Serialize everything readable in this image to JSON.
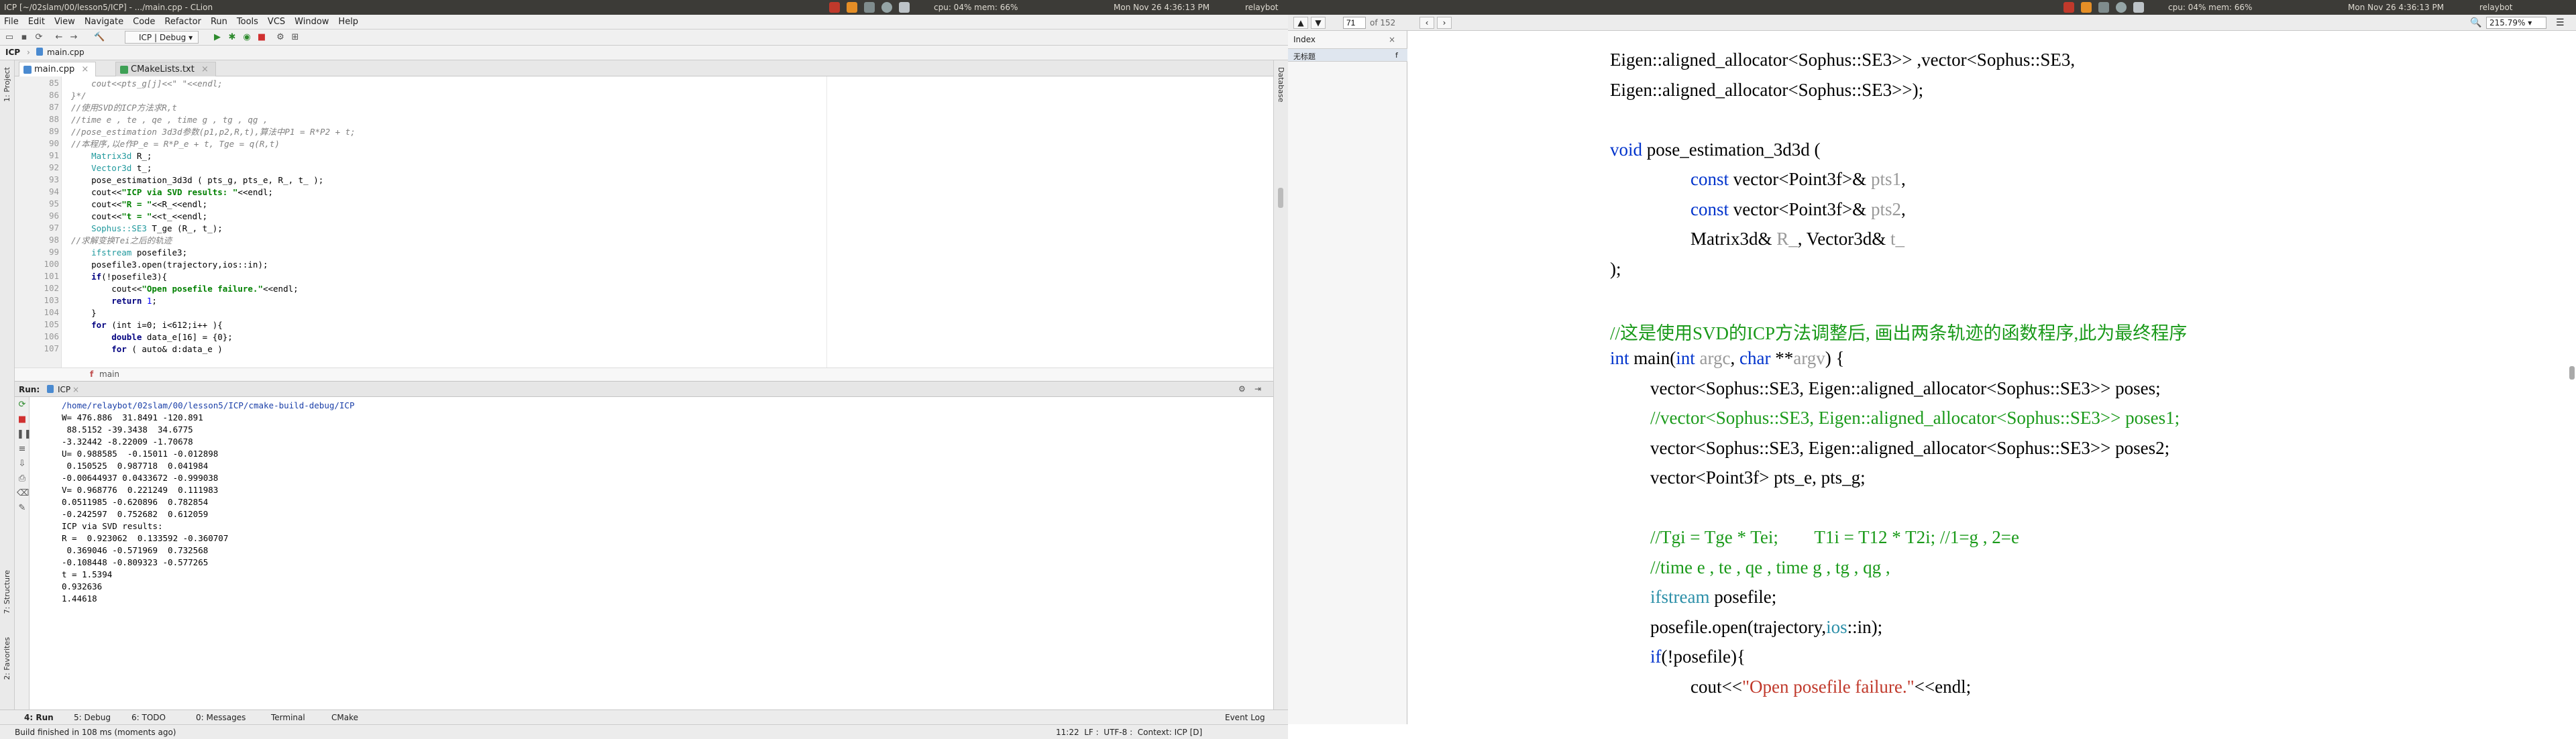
{
  "topbar": {
    "title": "ICP [~/02slam/00/lesson5/ICP] - .../main.cpp - CLion",
    "sys_left": "cpu: 04% mem: 66%",
    "clock_left": "Mon Nov 26 4:36:13 PM",
    "user_left": "relaybot",
    "sys_right": "cpu: 04% mem: 66%",
    "clock_right": "Mon Nov 26 4:36:13 PM",
    "user_right": "relaybot"
  },
  "ide": {
    "menu": [
      "File",
      "Edit",
      "View",
      "Navigate",
      "Code",
      "Refactor",
      "Run",
      "Tools",
      "VCS",
      "Window",
      "Help"
    ],
    "run_config": "ICP | Debug",
    "nav": {
      "project": "ICP",
      "file": "main.cpp"
    },
    "left_tabs": [
      "1: Project",
      "7: Structure",
      "2: Favorites"
    ],
    "right_tab": "Database",
    "tabs": [
      {
        "label": "main.cpp"
      },
      {
        "label": "CMakeLists.txt"
      }
    ],
    "crumb": "main",
    "code_lines": [
      {
        "n": "85",
        "segs": [
          [
            "cm",
            "    cout<<pts_g[j]<<\" \"<<endl;"
          ]
        ]
      },
      {
        "n": "86",
        "segs": [
          [
            "cm",
            "}*/"
          ]
        ]
      },
      {
        "n": "87",
        "segs": [
          [
            "cm",
            "//使用SVD的ICP方法求R,t"
          ]
        ]
      },
      {
        "n": "88",
        "segs": [
          [
            "cm",
            "//time e , te , qe , time g , tg , qg ,"
          ]
        ]
      },
      {
        "n": "89",
        "segs": [
          [
            "cm",
            "//pose_estimation 3d3d参数(p1,p2,R,t),算法中P1 = R*P2 + t;"
          ]
        ]
      },
      {
        "n": "90",
        "segs": [
          [
            "cm",
            "//本程序,以e作P_e = R*P_e + t, Tge = q(R,t)"
          ]
        ]
      },
      {
        "n": "91",
        "segs": [
          [
            "ty",
            "    Matrix3d"
          ],
          [
            "",
            "R_;"
          ]
        ]
      },
      {
        "n": "92",
        "segs": [
          [
            "ty",
            "    Vector3d"
          ],
          [
            "",
            "t_;"
          ]
        ]
      },
      {
        "n": "93",
        "segs": [
          [
            "",
            "    pose_estimation_3d3d ( pts_g, pts_e, R_, t_ );"
          ]
        ]
      },
      {
        "n": "94",
        "segs": [
          [
            "",
            "    cout<<"
          ],
          [
            "st",
            "\"ICP via SVD results: \""
          ],
          [
            "",
            "<<endl;"
          ]
        ]
      },
      {
        "n": "95",
        "segs": [
          [
            "",
            "    cout<<"
          ],
          [
            "st",
            "\"R = \""
          ],
          [
            "",
            "<<R_<<endl;"
          ]
        ]
      },
      {
        "n": "96",
        "segs": [
          [
            "",
            "    cout<<"
          ],
          [
            "st",
            "\"t = \""
          ],
          [
            "",
            "<<t_<<endl;"
          ]
        ]
      },
      {
        "n": "97",
        "segs": [
          [
            "ty",
            "    Sophus::SE3"
          ],
          [
            "",
            "T_ge (R_, t_);"
          ]
        ]
      },
      {
        "n": "98",
        "segs": [
          [
            "cm",
            "//求解变换Tei之后的轨迹"
          ]
        ]
      },
      {
        "n": "99",
        "segs": [
          [
            "ty",
            "    ifstream"
          ],
          [
            "",
            "posefile3;"
          ]
        ]
      },
      {
        "n": "100",
        "segs": [
          [
            "",
            "    posefile3.open(trajectory,ios::in);"
          ]
        ]
      },
      {
        "n": "101",
        "segs": [
          [
            "kw",
            "    if"
          ],
          [
            "",
            "(!posefile3){"
          ]
        ]
      },
      {
        "n": "102",
        "segs": [
          [
            "",
            "        cout<<"
          ],
          [
            "st",
            "\"Open posefile failure.\""
          ],
          [
            "",
            "<<endl;"
          ]
        ]
      },
      {
        "n": "103",
        "segs": [
          [
            "kw",
            "        return"
          ],
          [
            "num",
            " 1"
          ],
          [
            "",
            ";"
          ]
        ]
      },
      {
        "n": "104",
        "segs": [
          [
            "",
            "    }"
          ]
        ]
      },
      {
        "n": "105",
        "segs": [
          [
            "kw",
            "    for"
          ],
          [
            "",
            " (int i=0; i<612;i++ ){"
          ]
        ]
      },
      {
        "n": "106",
        "segs": [
          [
            "kw",
            "        double"
          ],
          [
            "",
            " data_e[16] = {0};"
          ]
        ]
      },
      {
        "n": "107",
        "segs": [
          [
            "kw",
            "        for"
          ],
          [
            "",
            " ( auto& d:data_e )"
          ]
        ]
      }
    ],
    "run": {
      "title": "Run:",
      "config": "ICP",
      "output": [
        "/home/relaybot/02slam/00/lesson5/ICP/cmake-build-debug/ICP",
        "W= 476.886  31.8491 -120.891",
        " 88.5152 -39.3438  34.6775",
        "-3.32442 -8.22009 -1.70678",
        "U= 0.988585  -0.15011 -0.012898",
        " 0.150525  0.987718  0.041984",
        "-0.00644937 0.0433672 -0.999038",
        "V= 0.968776  0.221249  0.111983",
        "0.0511985 -0.620896  0.782854",
        "-0.242597  0.752682  0.612059",
        "ICP via SVD results: ",
        "R =  0.923062  0.133592 -0.360707",
        " 0.369046 -0.571969  0.732568",
        "-0.108448 -0.809323 -0.577265",
        "t = 1.5394",
        "0.932636",
        "1.44618"
      ]
    },
    "bottom_tabs": [
      "4: Run",
      "5: Debug",
      "6: TODO",
      "0: Messages",
      "Terminal",
      "CMake"
    ],
    "event_log": "Event Log",
    "status_left": "Build finished in 108 ms (moments ago)",
    "status_right": "11:22  LF :  UTF-8 :  Context: ICP [D]"
  },
  "pdf": {
    "page_value": "71",
    "page_total": "of 152",
    "zoom": "215.79%",
    "side_title": "Index",
    "side_item": "无标题",
    "lines": [
      {
        "ind": 0,
        "segs": [
          [
            "",
            "Eigen::aligned_allocator<Sophus::SE3>> ,vector<Sophus::SE3,"
          ]
        ]
      },
      {
        "ind": 0,
        "segs": [
          [
            "",
            "Eigen::aligned_allocator<Sophus::SE3>>);"
          ]
        ]
      },
      {
        "ind": 0,
        "segs": []
      },
      {
        "ind": 0,
        "segs": [
          [
            "pk",
            "void"
          ],
          [
            "",
            " pose_estimation_3d3d ("
          ]
        ]
      },
      {
        "ind": 2,
        "segs": [
          [
            "pk",
            "const"
          ],
          [
            "",
            " vector<Point3f>& "
          ],
          [
            "pp",
            "pts1"
          ],
          [
            "",
            ","
          ]
        ]
      },
      {
        "ind": 2,
        "segs": [
          [
            "pk",
            "const"
          ],
          [
            "",
            " vector<Point3f>& "
          ],
          [
            "pp",
            "pts2"
          ],
          [
            "",
            ","
          ]
        ]
      },
      {
        "ind": 2,
        "segs": [
          [
            "",
            "Matrix3d& "
          ],
          [
            "pp",
            "R_"
          ],
          [
            "",
            ", Vector3d& "
          ],
          [
            "pp",
            "t_"
          ]
        ]
      },
      {
        "ind": 0,
        "segs": [
          [
            "",
            ");"
          ]
        ]
      },
      {
        "ind": 0,
        "segs": []
      },
      {
        "ind": 0,
        "segs": [
          [
            "pg",
            "//这是使用SVD的ICP方法调整后, 画出两条轨迹的函数程序,此为最终程序"
          ]
        ]
      },
      {
        "ind": 0,
        "segs": [
          [
            "pk",
            "int"
          ],
          [
            "",
            " main("
          ],
          [
            "pk",
            "int"
          ],
          [
            "",
            " "
          ],
          [
            "pp",
            "argc"
          ],
          [
            "",
            ", "
          ],
          [
            "pk",
            "char"
          ],
          [
            "",
            " **"
          ],
          [
            "pp",
            "argv"
          ],
          [
            "",
            ") {"
          ]
        ]
      },
      {
        "ind": 1,
        "segs": [
          [
            "",
            "vector<Sophus::SE3, Eigen::aligned_allocator<Sophus::SE3>> poses;"
          ]
        ]
      },
      {
        "ind": 1,
        "segs": [
          [
            "pg",
            "//vector<Sophus::SE3, Eigen::aligned_allocator<Sophus::SE3>> poses1;"
          ]
        ]
      },
      {
        "ind": 1,
        "segs": [
          [
            "",
            "vector<Sophus::SE3, Eigen::aligned_allocator<Sophus::SE3>> poses2;"
          ]
        ]
      },
      {
        "ind": 1,
        "segs": [
          [
            "",
            "vector<Point3f> pts_e, pts_g;"
          ]
        ]
      },
      {
        "ind": 0,
        "segs": []
      },
      {
        "ind": 1,
        "segs": [
          [
            "pg",
            "//Tgi = Tge * Tei;        T1i = T12 * T2i; //1=g , 2=e"
          ]
        ]
      },
      {
        "ind": 1,
        "segs": [
          [
            "pg",
            "//time e , te , qe , time g , tg , qg ,"
          ]
        ]
      },
      {
        "ind": 1,
        "segs": [
          [
            "pt",
            "ifstream"
          ],
          [
            "",
            " posefile;"
          ]
        ]
      },
      {
        "ind": 1,
        "segs": [
          [
            "",
            "posefile.open(trajectory,"
          ],
          [
            "pt",
            "ios"
          ],
          [
            "",
            "::in);"
          ]
        ]
      },
      {
        "ind": 1,
        "segs": [
          [
            "pk",
            "if"
          ],
          [
            "",
            "(!posefile){"
          ]
        ]
      },
      {
        "ind": 2,
        "segs": [
          [
            "",
            "cout<<"
          ],
          [
            "pr",
            "\"Open posefile failure.\""
          ],
          [
            "",
            "<<endl;"
          ]
        ]
      }
    ]
  }
}
